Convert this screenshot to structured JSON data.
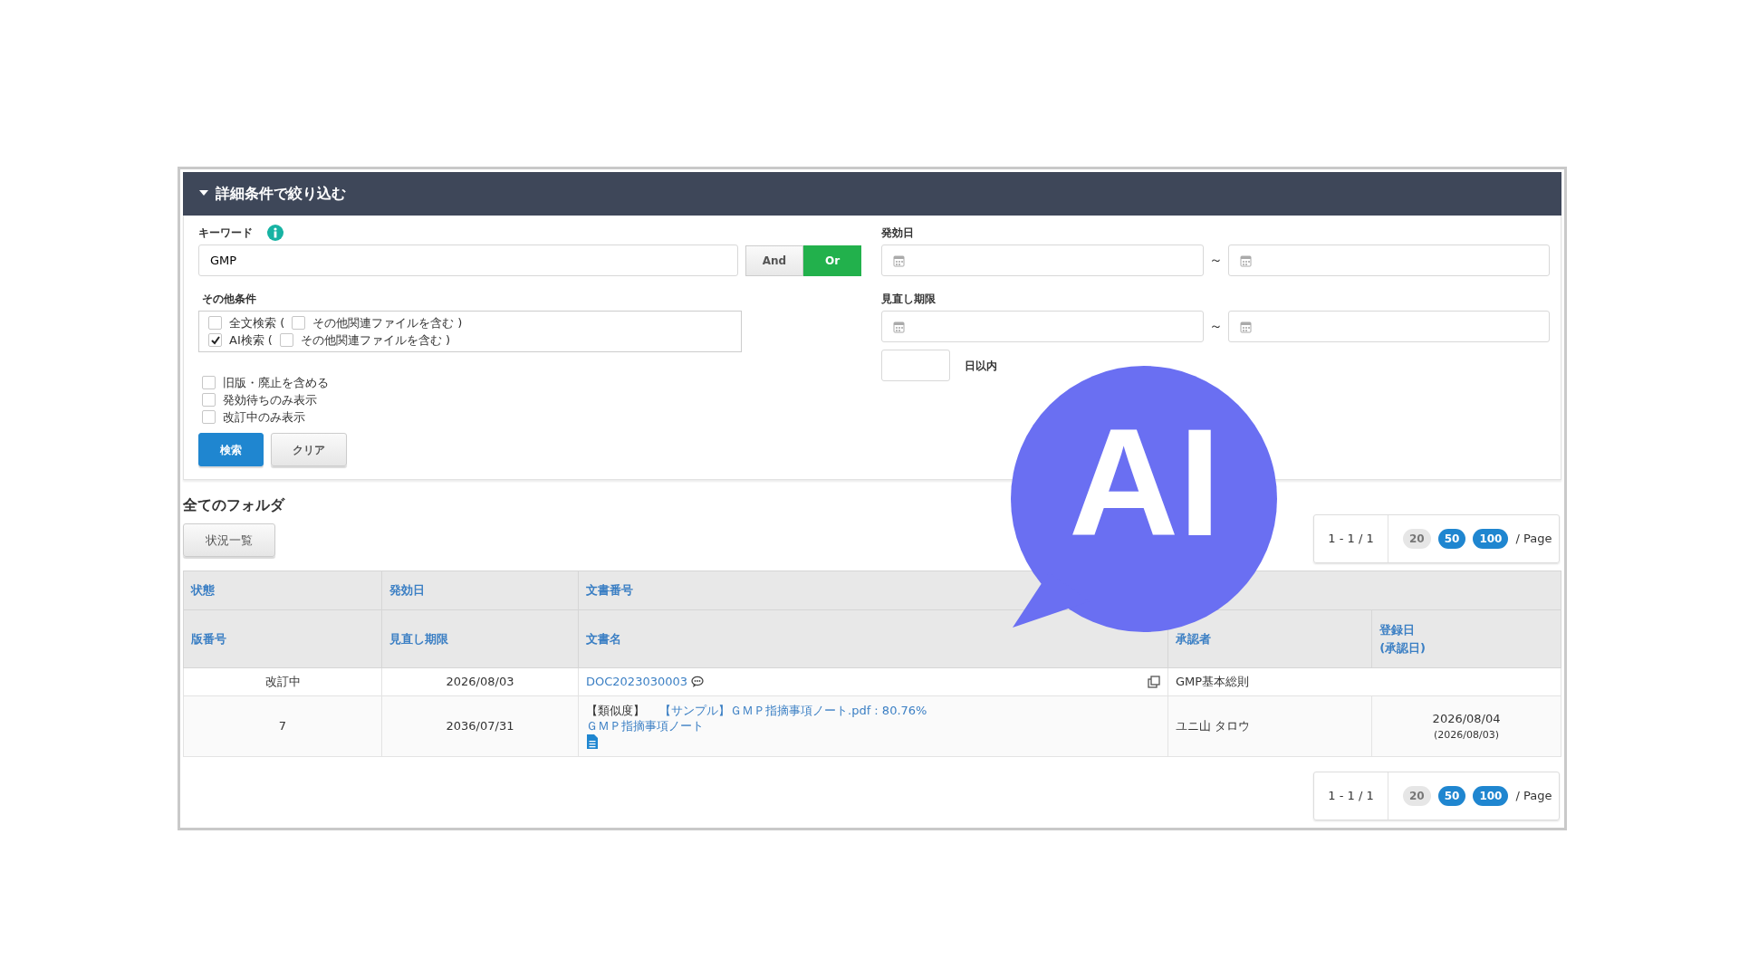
{
  "panel": {
    "title": "詳細条件で絞り込む",
    "expanded": true
  },
  "keyword": {
    "label": "キーワード",
    "value": "GMP",
    "modes": [
      {
        "label": "And",
        "selected": false
      },
      {
        "label": "Or",
        "selected": true
      }
    ]
  },
  "other_conditions": {
    "label": "その他条件",
    "search_options": [
      {
        "label": "全文検索 (",
        "checked": false,
        "sub_label": "その他関連ファイルを含む )",
        "sub_checked": false
      },
      {
        "label": "AI検索 (",
        "checked": true,
        "sub_label": "その他関連ファイルを含む )",
        "sub_checked": false
      }
    ],
    "filters": [
      {
        "label": "旧版・廃止を含める",
        "checked": false
      },
      {
        "label": "発効待ちのみ表示",
        "checked": false
      },
      {
        "label": "改訂中のみ表示",
        "checked": false
      }
    ]
  },
  "buttons": [
    {
      "label": "検索",
      "kind": "primary"
    },
    {
      "label": "クリア",
      "kind": "secondary"
    }
  ],
  "effective_date": {
    "label": "発効日",
    "separator": "～"
  },
  "review_deadline": {
    "label": "見直し期限",
    "separator": "～"
  },
  "within_days": {
    "label": "日以内"
  },
  "folder": {
    "title": "全てのフォルダ",
    "status_button": "状況一覧"
  },
  "pagination_top": {
    "range": "1 - 1 / 1",
    "sizes": [
      {
        "label": "20",
        "selected": true
      },
      {
        "label": "50",
        "selected": false
      },
      {
        "label": "100",
        "selected": false
      }
    ],
    "suffix": "/ Page"
  },
  "table": {
    "header_rows": [
      [
        "状態",
        "発効日",
        "文書番号"
      ],
      [
        "版番号",
        "見直し期限",
        "文書名",
        "承認者",
        "登録日\n(承認日)"
      ]
    ],
    "rows": [
      {
        "status": "改訂中",
        "effective_date": "2026/08/03",
        "doc_number": "DOC2023030003",
        "category": "GMP基本総則",
        "version": "7",
        "review_deadline": "2036/07/31",
        "similarity_label": "【類似度】",
        "similarity_link": "【サンプル】ＧＭＰ指摘事項ノート.pdf : 80.76%",
        "doc_name": "ＧＭＰ指摘事項ノート",
        "approver": "ユニ山 タロウ",
        "registered": "2026/08/04",
        "approved": "(2026/08/03)"
      }
    ]
  },
  "pagination_bottom": {
    "range": "1 - 1 / 1",
    "sizes": [
      {
        "label": "20",
        "selected": true
      },
      {
        "label": "50",
        "selected": false
      },
      {
        "label": "100",
        "selected": false
      }
    ],
    "suffix": "/ Page"
  },
  "overlay": {
    "text": "AI"
  }
}
